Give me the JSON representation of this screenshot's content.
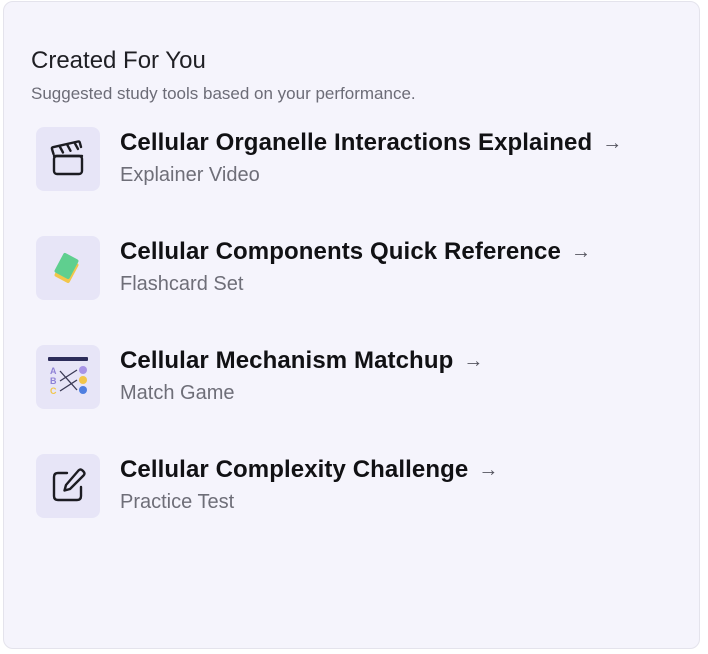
{
  "section": {
    "title": "Created For You",
    "subtitle": "Suggested study tools based on your performance."
  },
  "items": [
    {
      "title": "Cellular Organelle Interactions Explained",
      "type": "Explainer Video",
      "icon": "clapperboard-icon"
    },
    {
      "title": "Cellular Components Quick Reference",
      "type": "Flashcard Set",
      "icon": "flashcards-icon"
    },
    {
      "title": "Cellular Mechanism Matchup",
      "type": "Match Game",
      "icon": "match-game-icon"
    },
    {
      "title": "Cellular Complexity Challenge",
      "type": "Practice Test",
      "icon": "edit-icon"
    }
  ],
  "arrow": "→",
  "colors": {
    "card_bg": "#f5f4fc",
    "tile_bg": "#e7e5f7",
    "flashcard_green": "#5fcf8f",
    "flashcard_yellow": "#f2c64a",
    "match_purple": "#a894e6",
    "match_blue": "#4f7fe0"
  }
}
